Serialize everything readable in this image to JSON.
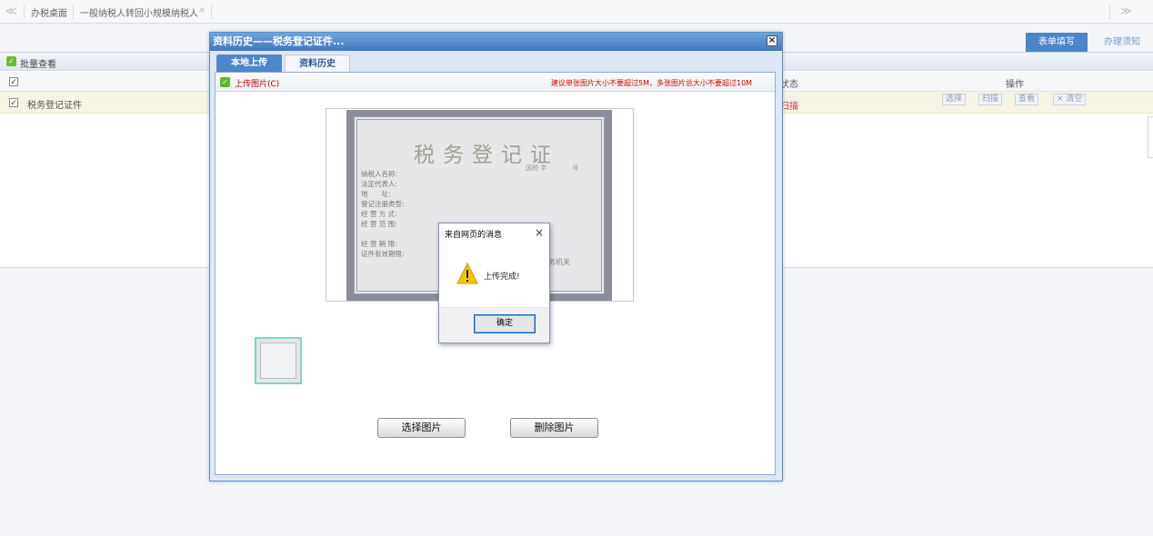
{
  "nav": {
    "prev_arrow": "≪",
    "next_arrow": "≫",
    "tabs": [
      {
        "label": "办税桌面"
      },
      {
        "label": "一般纳税人转回小规模纳税人",
        "close": "×"
      }
    ]
  },
  "header_buttons": {
    "form": "表单填写",
    "notice": "办理须知"
  },
  "panel": {
    "batch_label": "批量查看",
    "columns": {
      "status": "状态",
      "ops": "操作"
    },
    "rows": [
      {
        "label": "税务登记证件",
        "status": "扫描"
      }
    ],
    "ops_buttons": [
      "选择",
      "扫描",
      "查看",
      "× 清空"
    ]
  },
  "dialog": {
    "title": "资料历史——税务登记证件...",
    "close": "×",
    "tabs": {
      "local": "本地上传",
      "history": "资料历史"
    },
    "upload_label": "上传图片(C)",
    "upload_hint": "建议单张图片大小不要超过5M，多张图片总大小不要超过10M",
    "preview": {
      "cert_title": "税务登记证",
      "cert_no": "国税 字　　　　号",
      "cert_fields": [
        "纳税人名称:",
        "法定代表人:",
        "地　　址:",
        "登记注册类型:",
        "经 营 方 式:",
        "经 营 范 围:",
        "",
        "经 营 期 限:",
        "证件有效期限:"
      ],
      "cert_org": "税务机关"
    },
    "buttons": {
      "select": "选择图片",
      "delete": "删除图片"
    }
  },
  "alert": {
    "title": "来自网页的消息",
    "close": "×",
    "message": "上传完成!",
    "ok": "确定",
    "warn_color": "#f5c400"
  }
}
